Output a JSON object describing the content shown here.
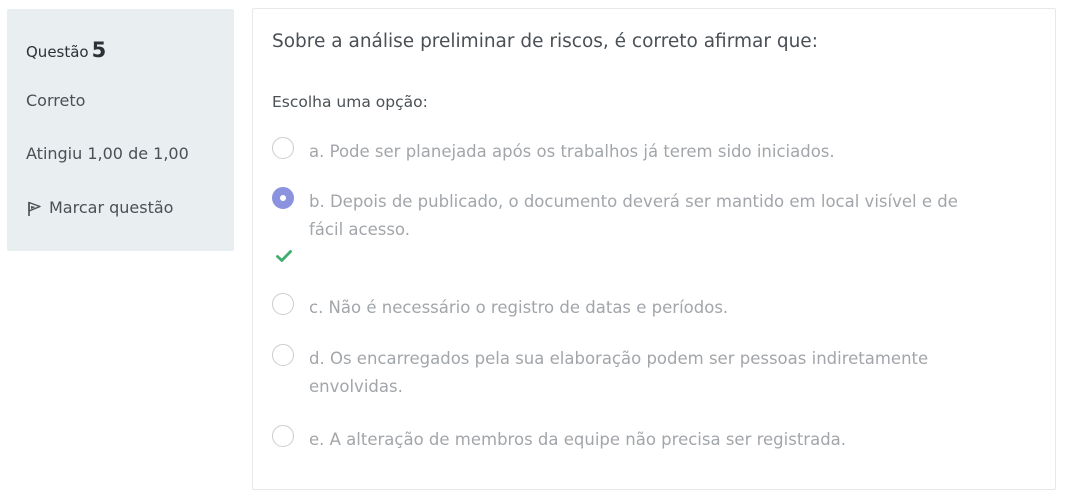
{
  "info": {
    "question_label": "Questão",
    "question_number": "5",
    "state": "Correto",
    "grade": "Atingiu 1,00 de 1,00",
    "flag_label": "Marcar questão"
  },
  "question": {
    "text": "Sobre a análise preliminar de riscos, é correto afirmar que:",
    "prompt": "Escolha uma opção:",
    "selected": "b",
    "options": [
      {
        "key": "a",
        "label": "a. Pode ser planejada após os trabalhos já terem sido iniciados."
      },
      {
        "key": "b",
        "label": "b. Depois de publicado, o documento deverá ser mantido em local visível e de fácil acesso."
      },
      {
        "key": "c",
        "label": "c. Não é necessário o registro de datas e períodos."
      },
      {
        "key": "d",
        "label": "d. Os encarregados pela sua elaboração podem ser pessoas indiretamente envolvidas."
      },
      {
        "key": "e",
        "label": "e. A alteração de membros da equipe não precisa ser registrada."
      }
    ]
  },
  "colors": {
    "info_bg": "#e9eef0",
    "radio_selected": "#8b93de",
    "correct_check": "#3fae6d",
    "option_text": "#a2a6aa"
  },
  "icons": {
    "flag": "flag-icon",
    "correct": "check-icon"
  }
}
